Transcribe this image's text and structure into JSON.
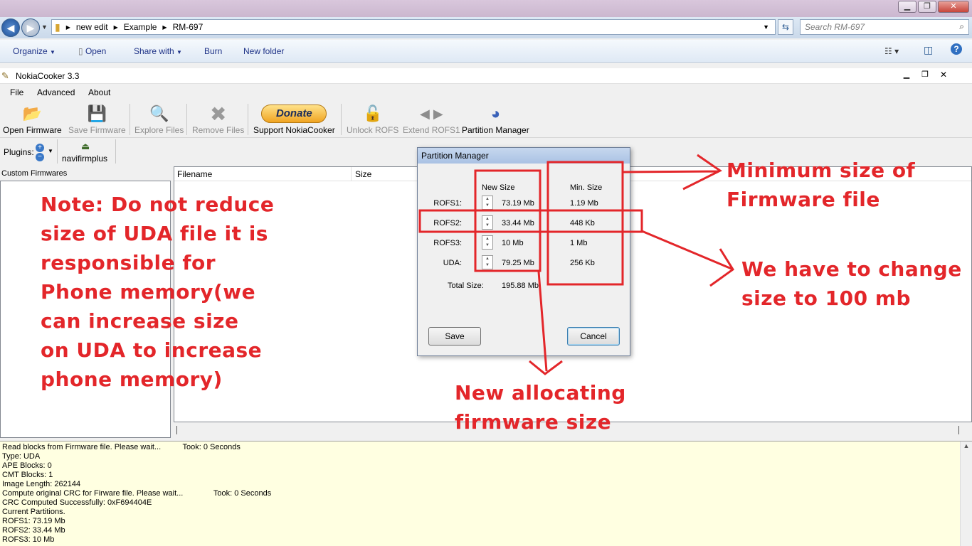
{
  "explorer": {
    "address": [
      "new edit",
      "Example",
      "RM-697"
    ],
    "search_placeholder": "Search RM-697",
    "commands": [
      "Organize",
      "Open",
      "Share with",
      "Burn",
      "New folder"
    ]
  },
  "app": {
    "title": "NokiaCooker 3.3",
    "menu": [
      "File",
      "Advanced",
      "About"
    ],
    "toolbar": {
      "open_firmware": "Open Firmware",
      "save_firmware": "Save Firmware",
      "explore_files": "Explore Files",
      "remove_files": "Remove Files",
      "donate": "Donate",
      "support": "Support NokiaCooker",
      "unlock_rofs": "Unlock ROFS",
      "extend_rofs1": "Extend ROFS1",
      "partition_manager": "Partition Manager"
    },
    "plugins_label": "Plugins:",
    "plugin_name": "navifirmplus",
    "custom_firmwares_label": "Custom Firmwares",
    "files_columns": [
      "Filename",
      "Size"
    ]
  },
  "log": [
    "Read blocks from Firmware file. Please wait...          Took: 0 Seconds",
    "Type: UDA",
    "APE Blocks: 0",
    "CMT Blocks: 1",
    "Image Length: 262144",
    "Compute original CRC for Firware file. Please wait...              Took: 0 Seconds",
    "CRC Computed Successfully: 0xF694404E",
    "Current Partitions.",
    "ROFS1: 73.19 Mb",
    "ROFS2: 33.44 Mb",
    "ROFS3: 10 Mb"
  ],
  "dialog": {
    "title": "Partition Manager",
    "new_size_header": "New Size",
    "min_size_header": "Min. Size",
    "rows": [
      {
        "label": "ROFS1:",
        "new": "73.19 Mb",
        "min": "1.19 Mb"
      },
      {
        "label": "ROFS2:",
        "new": "33.44 Mb",
        "min": "448 Kb"
      },
      {
        "label": "ROFS3:",
        "new": "10 Mb",
        "min": "1 Mb"
      },
      {
        "label": "UDA:",
        "new": "79.25 Mb",
        "min": "256 Kb"
      }
    ],
    "total_label": "Total Size:",
    "total_value": "195.88 Mb",
    "save": "Save",
    "cancel": "Cancel"
  },
  "annotations": {
    "note": [
      "Note: Do not reduce",
      "size of UDA file it is",
      "responsible for",
      "Phone memory(we",
      "can increase size",
      "on UDA to increase",
      "phone memory)"
    ],
    "min_size": [
      "Minimum size of",
      "Firmware file"
    ],
    "change": [
      "We have to change",
      "size to 100 mb"
    ],
    "new_alloc": [
      "New allocating",
      "firmware size"
    ],
    "color": "#e3262a"
  }
}
